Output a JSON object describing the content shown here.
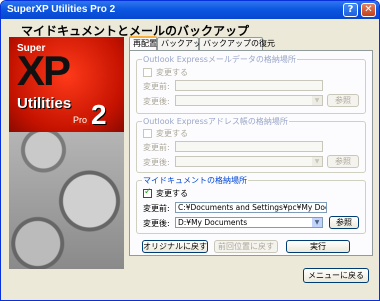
{
  "title_bar": {
    "title": "SuperXP Utilities Pro 2",
    "help": "?",
    "close": "✕"
  },
  "heading": "マイドキュメントとメールのバックアップ",
  "logo": {
    "super": "Super",
    "xp": "XP",
    "utilities": "Utilities",
    "pro": "Pro",
    "two": "2"
  },
  "tabs": [
    {
      "label": "再配置",
      "active": true
    },
    {
      "label": "バックアップ",
      "active": false
    },
    {
      "label": "バックアップの復元",
      "active": false
    }
  ],
  "groups": {
    "outlook_mail": {
      "legend": "Outlook Expressメールデータの格納場所",
      "checkbox_label": "変更する",
      "checked": false,
      "before_label": "変更前:",
      "before_value": "",
      "after_label": "変更後:",
      "after_value": "",
      "browse": "参照"
    },
    "outlook_address": {
      "legend": "Outlook Expressアドレス帳の格納場所",
      "checkbox_label": "変更する",
      "checked": false,
      "before_label": "変更前:",
      "before_value": "",
      "after_label": "変更後:",
      "after_value": "",
      "browse": "参照"
    },
    "my_documents": {
      "legend": "マイドキュメントの格納場所",
      "checkbox_label": "変更する",
      "checked": true,
      "before_label": "変更前:",
      "before_value": "C:¥Documents and Settings¥pc¥My Documents",
      "after_label": "変更後:",
      "after_value": "D:¥My Documents",
      "browse": "参照"
    }
  },
  "actions": {
    "restore_original": "オリジナルに戻す",
    "restore_previous": "前回位置に戻す",
    "execute": "実行"
  },
  "back_to_menu": "メニューに戻る"
}
